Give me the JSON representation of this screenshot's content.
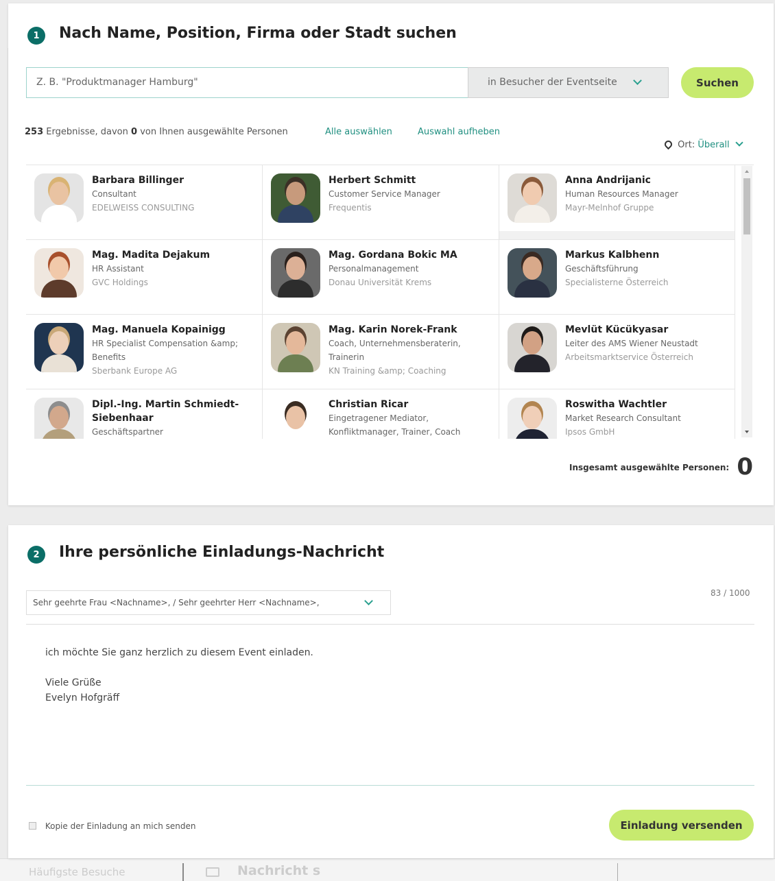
{
  "step1": {
    "number": "1",
    "title": "Nach Name, Position, Firma oder Stadt suchen",
    "search_placeholder": "Z. B. \"Produktmanager Hamburg\"",
    "scope_label": "in Besucher der Eventseite",
    "search_button": "Suchen",
    "results_count": "253",
    "results_text_a": "Ergebnisse, davon",
    "results_selected": "0",
    "results_text_b": "von Ihnen ausgewählte Personen",
    "select_all": "Alle auswählen",
    "clear_selection": "Auswahl aufheben",
    "location_label": "Ort:",
    "location_value": "Überall",
    "total_label": "Insgesamt ausgewählte Personen:",
    "total_value": "0"
  },
  "people": [
    {
      "name": "Barbara Billinger",
      "position": "Consultant",
      "company": "EDELWEISS CONSULTING",
      "skin": "#e9c3a2",
      "hair": "#d9b373",
      "cloth": "#ffffff",
      "bg": "#e4e4e4"
    },
    {
      "name": "Herbert Schmitt",
      "position": "Customer Service Manager",
      "company": "Frequentis",
      "skin": "#c79a7c",
      "hair": "#3b3026",
      "cloth": "#2f4262",
      "bg": "#3f5b34"
    },
    {
      "name": "Anna Andrijanic",
      "position": "Human Resources Manager",
      "company": "Mayr-Melnhof Gruppe",
      "skin": "#f0cbb0",
      "hair": "#8a5a3a",
      "cloth": "#f3efe9",
      "bg": "#dedbd6"
    },
    {
      "name": "Mag. Madita Dejakum",
      "position": "HR Assistant",
      "company": "GVC Holdings",
      "skin": "#f1c9aa",
      "hair": "#a8502c",
      "cloth": "#5d3b2b",
      "bg": "#efe7df"
    },
    {
      "name": "Mag. Gordana Bokic MA",
      "position": "Personalmanagement",
      "company": "Donau Universität Krems",
      "skin": "#dcb096",
      "hair": "#2a201c",
      "cloth": "#2d2d2d",
      "bg": "#6a6a6a"
    },
    {
      "name": "Markus Kalbhenn",
      "position": "Geschäftsführung",
      "company": "Specialisterne Österreich",
      "skin": "#d8a98a",
      "hair": "#3a2a22",
      "cloth": "#2a3142",
      "bg": "#44525a"
    },
    {
      "name": "Mag. Manuela Kopainigg",
      "position": "HR Specialist Compensation &amp; Benefits",
      "company": "Sberbank Europe AG",
      "skin": "#edd0b9",
      "hair": "#c9a878",
      "cloth": "#e9e1d6",
      "bg": "#1f3550"
    },
    {
      "name": "Mag. Karin Norek-Frank",
      "position": "Coach, Unternehmensberaterin, Trainerin",
      "company": "KN Training &amp; Coaching",
      "skin": "#e4b89a",
      "hair": "#5b4332",
      "cloth": "#6d7f52",
      "bg": "#cfc7b5"
    },
    {
      "name": "Mevlüt Kücükyasar",
      "position": "Leiter des AMS Wiener Neustadt",
      "company": "Arbeitsmarktservice Österreich",
      "skin": "#d2a184",
      "hair": "#1e1a18",
      "cloth": "#23232b",
      "bg": "#d8d6d2"
    },
    {
      "name": "Dipl.-Ing. Martin Schmiedt-Siebenhaar",
      "position": "Geschäftspartner",
      "company": "",
      "skin": "#d2a88c",
      "hair": "#8d8d8d",
      "cloth": "#b39f7c",
      "bg": "#e8e8e8"
    },
    {
      "name": "Christian Ricar",
      "position": "Eingetragener Mediator, Konfliktmanager, Trainer, Coach",
      "company": "",
      "skin": "#e9c2a6",
      "hair": "#3a2c22",
      "cloth": "#ffffff",
      "bg": "#ffffff"
    },
    {
      "name": "Roswitha Wachtler",
      "position": "Market Research Consultant",
      "company": "Ipsos GmbH",
      "skin": "#f0cfb8",
      "hair": "#b28550",
      "cloth": "#1f2333",
      "bg": "#ededed"
    }
  ],
  "step2": {
    "number": "2",
    "title": "Ihre persönliche Einladungs-Nachricht",
    "salutation": "Sehr geehrte Frau <Nachname>, / Sehr geehrter Herr <Nachname>,",
    "char_count": "83 / 1000",
    "message_line1": "ich möchte Sie ganz herzlich zu diesem Event einladen.",
    "message_line2": "Viele Grüße",
    "message_line3": "Evelyn Hofgräff",
    "copy_label": "Kopie der Einladung an mich senden",
    "send_button": "Einladung versenden"
  },
  "background": {
    "item1": "Häufigste Besuche",
    "item2": "Nachricht s"
  }
}
